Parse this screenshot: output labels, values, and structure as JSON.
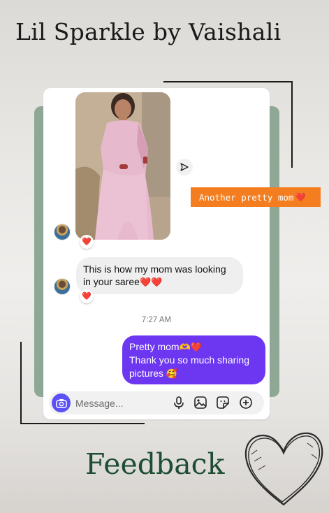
{
  "story": {
    "title": "Lil Sparkle by Vaishali",
    "tag_text": "Another pretty mom",
    "tag_emoji": "❤️",
    "footer_text": "Feedback"
  },
  "chat": {
    "incoming_line1": "This is how my mom was looking",
    "incoming_line2": "in your saree",
    "incoming_emoji": "❤️❤️",
    "timestamp": "7:27 AM",
    "outgoing_line1": "Pretty mom",
    "outgoing_line1_emoji": "🫶❤️",
    "outgoing_line2": "Thank you so much sharing",
    "outgoing_line3": "pictures",
    "outgoing_line3_emoji": "🥰",
    "reaction_emoji": "❤️"
  },
  "composer": {
    "placeholder": "Message...",
    "icons": [
      "camera-icon",
      "microphone-icon",
      "gallery-icon",
      "sticker-icon",
      "add-icon"
    ]
  },
  "colors": {
    "accent_purple": "#6d37f2",
    "camera_blue": "#5b51f5",
    "tag_orange": "#f47e1f",
    "feedback_green": "#1e4d33",
    "card_back_green": "#8fa896"
  }
}
